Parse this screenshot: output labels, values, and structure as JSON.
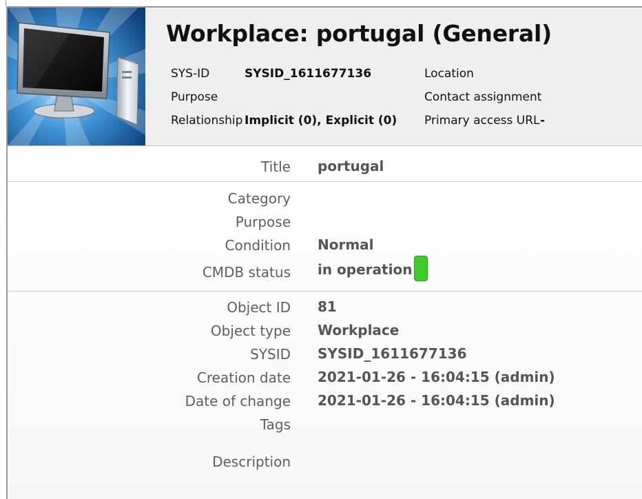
{
  "header": {
    "title": "Workplace: portugal (General)",
    "sys_id_label": "SYS-ID",
    "sys_id_value": "SYSID_1611677136",
    "purpose_label": "Purpose",
    "relationship_label": "Relationship",
    "relationship_value": "Implicit (0), Explicit (0)",
    "location_label": "Location",
    "contact_label": "Contact assignment",
    "access_url_label": "Primary access URL",
    "access_url_value": "-"
  },
  "details": {
    "title_label": "Title",
    "title_value": "portugal",
    "category_label": "Category",
    "purpose_label": "Purpose",
    "condition_label": "Condition",
    "condition_value": "Normal",
    "cmdb_label": "CMDB status",
    "cmdb_value": "in operation",
    "object_id_label": "Object ID",
    "object_id_value": "81",
    "object_type_label": "Object type",
    "object_type_value": "Workplace",
    "sysid_label": "SYSID",
    "sysid_value": "SYSID_1611677136",
    "creation_label": "Creation date",
    "creation_value": "2021-01-26 - 16:04:15 (admin)",
    "change_label": "Date of change",
    "change_value": "2021-01-26 - 16:04:15 (admin)",
    "tags_label": "Tags",
    "description_label": "Description"
  },
  "colors": {
    "status_green": "#3fcb2c",
    "header_bg": "#efefef",
    "label_gray": "#5e5e5e",
    "value_gray": "#555555"
  },
  "icons": {
    "hero": "workplace-computer-icon",
    "status": "cmdb-status-indicator"
  }
}
